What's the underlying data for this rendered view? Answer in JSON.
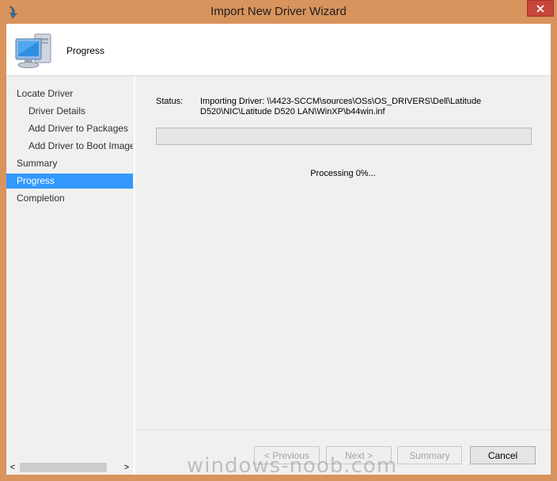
{
  "window": {
    "title": "Import New Driver Wizard",
    "close_glyph": "✕"
  },
  "header": {
    "title": "Progress",
    "icon": "computer-icon"
  },
  "nav": {
    "items": [
      {
        "label": "Locate Driver",
        "indent": false,
        "selected": false
      },
      {
        "label": "Driver Details",
        "indent": true,
        "selected": false
      },
      {
        "label": "Add Driver to Packages",
        "indent": true,
        "selected": false
      },
      {
        "label": "Add Driver to Boot Images",
        "indent": true,
        "selected": false
      },
      {
        "label": "Summary",
        "indent": false,
        "selected": false
      },
      {
        "label": "Progress",
        "indent": false,
        "selected": true
      },
      {
        "label": "Completion",
        "indent": false,
        "selected": false
      }
    ]
  },
  "main": {
    "status_label": "Status:",
    "status_text": "Importing Driver: \\\\4423-SCCM\\sources\\OSs\\OS_DRIVERS\\Dell\\Latitude D520\\NIC\\Latitude D520 LAN\\WinXP\\b44win.inf",
    "progress_percent": 0,
    "processing_text": "Processing 0%..."
  },
  "buttons": {
    "previous": "< Previous",
    "next": "Next >",
    "summary": "Summary",
    "cancel": "Cancel"
  },
  "scrollbar": {
    "left_arrow": "<",
    "right_arrow": ">"
  },
  "watermark": "windows-noob.com",
  "colors": {
    "window_frame": "#d9935c",
    "close_button": "#c7463b",
    "selection": "#3399ff"
  }
}
